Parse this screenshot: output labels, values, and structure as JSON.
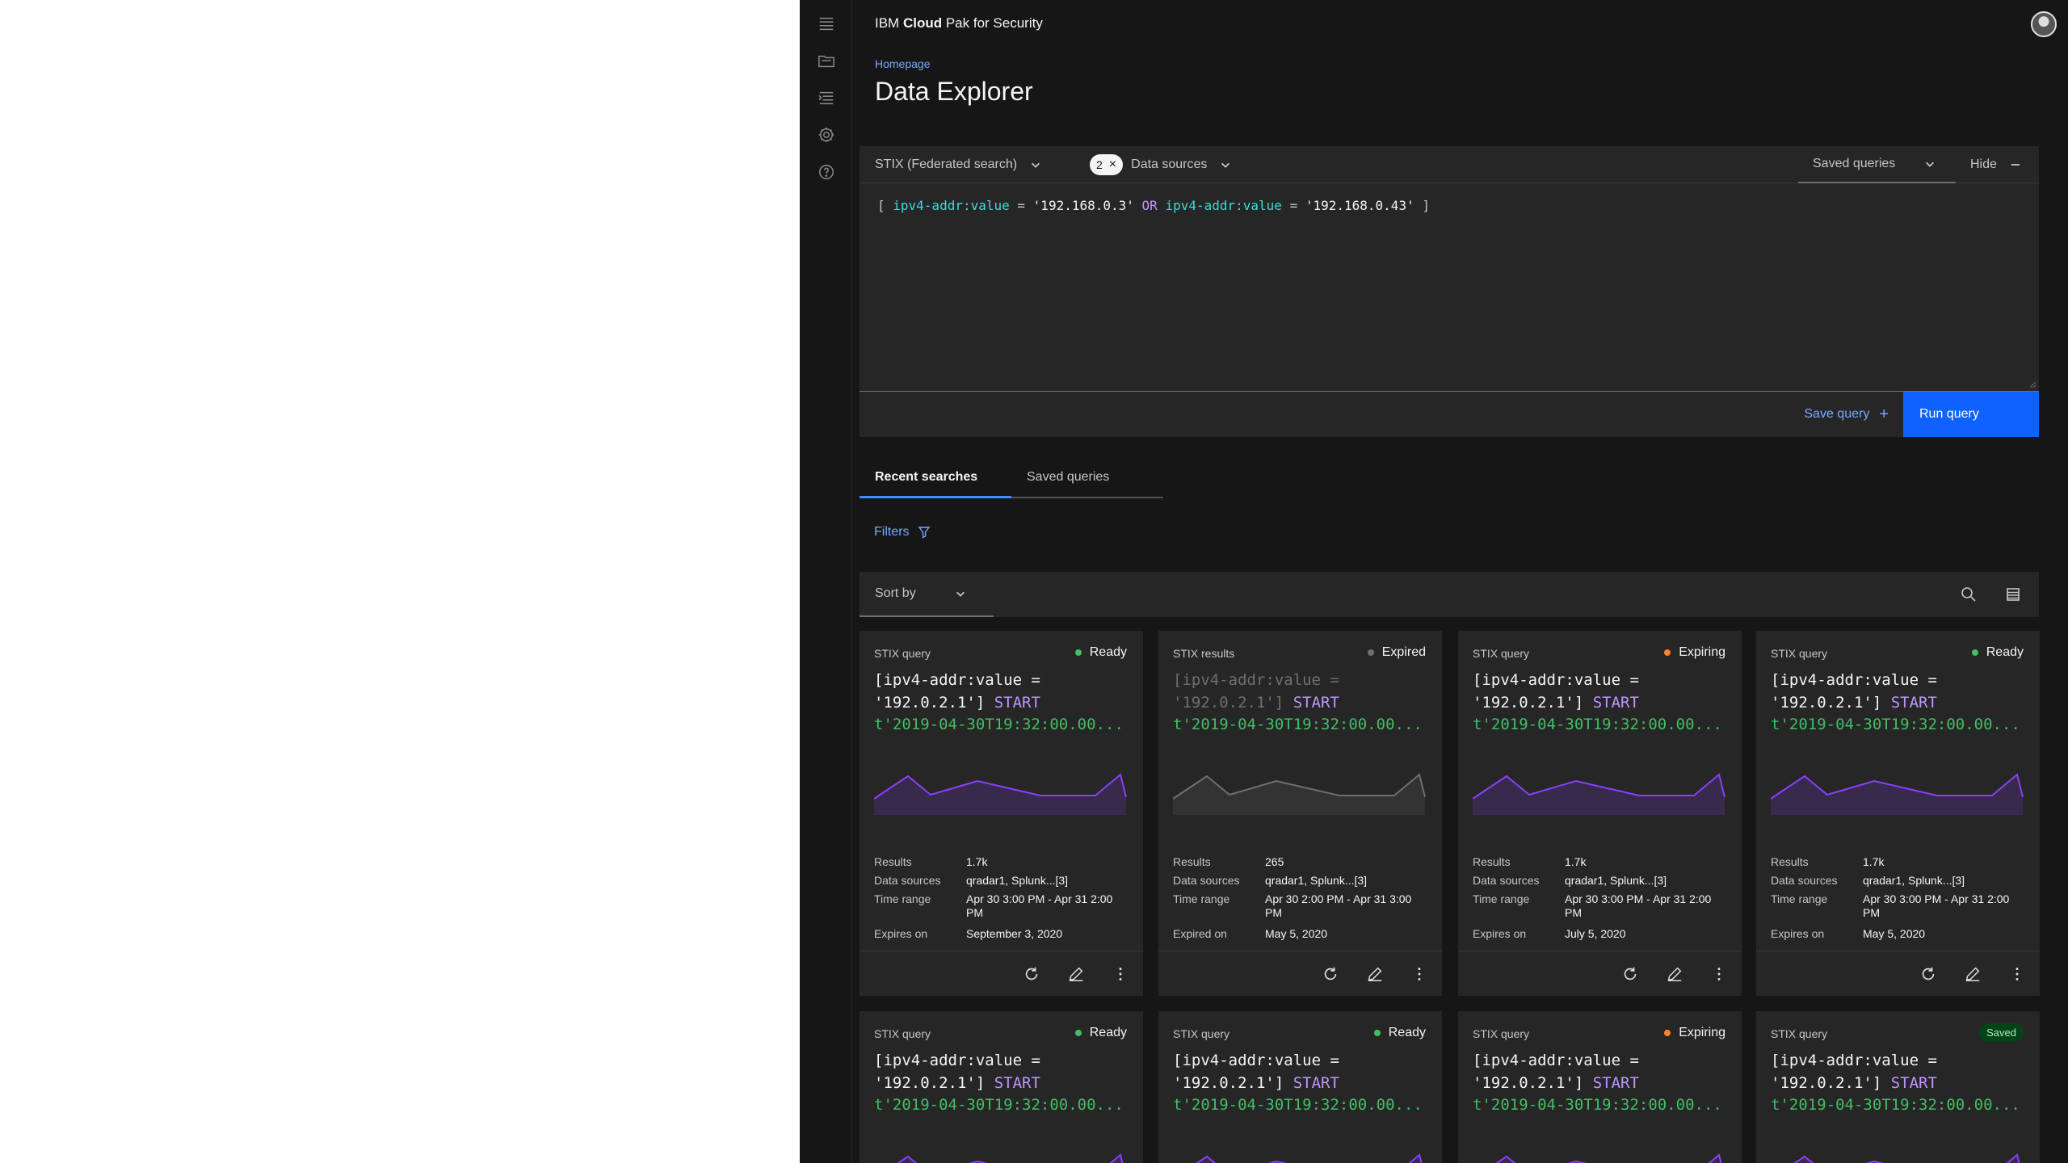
{
  "header": {
    "brand_prefix": "IBM ",
    "brand_bold": "Cloud",
    "brand_suffix": " Pak for Security",
    "icons": [
      "notification-icon",
      "user-avatar"
    ]
  },
  "rail": {
    "icons": [
      "menu-icon",
      "folder-icon",
      "list-icon",
      "settings-icon",
      "help-icon"
    ]
  },
  "breadcrumb": "Homepage",
  "page_title": "Data Explorer",
  "query": {
    "language": "STIX (Federated search)",
    "data_sources_count": "2",
    "data_sources_label": "Data sources",
    "saved_queries_label": "Saved queries",
    "hide_label": "Hide",
    "code": {
      "open": "[ ",
      "attr1": "ipv4-addr:value",
      "eq1": " = ",
      "val1": "'192.168.0.3'",
      "op": " OR ",
      "attr2": "ipv4-addr:value",
      "eq2": " = ",
      "val2": "'192.168.0.43'",
      "close": " ]"
    },
    "save_label": "Save query",
    "run_label": "Run query"
  },
  "tabs": [
    "Recent searches",
    "Saved queries"
  ],
  "filters_label": "Filters",
  "sort_label": "Sort by",
  "colors": {
    "ready": "#42be65",
    "expired": "#6f6f6f",
    "expiring": "#ff832b",
    "accent": "#0f62fe",
    "spark": "#8a3ffc"
  },
  "cards": [
    {
      "type": "STIX query",
      "status": "Ready",
      "q1": "[ipv4-addr:value =",
      "q2a": "'192.0.2.1'] ",
      "q2b": "START",
      "q3": "t'2019-04-30T19:32:00.00...",
      "results": "1.7k",
      "sources": "qradar1, Splunk...[3]",
      "time_range": "Apr 30 3:00 PM - Apr 31 2:00 PM",
      "exp_label": "Expires on",
      "exp_date": "September 3, 2020"
    },
    {
      "type": "STIX results",
      "status": "Expired",
      "q1": "[ipv4-addr:value =",
      "q2a": "'192.0.2.1'] ",
      "q2b": "START",
      "q3": "t'2019-04-30T19:32:00.00...",
      "results": "265",
      "sources": "qradar1, Splunk...[3]",
      "time_range": "Apr 30 2:00 PM - Apr 31 3:00 PM",
      "exp_label": "Expired on",
      "exp_date": "May 5, 2020"
    },
    {
      "type": "STIX query",
      "status": "Expiring",
      "q1": "[ipv4-addr:value =",
      "q2a": "'192.0.2.1'] ",
      "q2b": "START",
      "q3": "t'2019-04-30T19:32:00.00...",
      "results": "1.7k",
      "sources": "qradar1, Splunk...[3]",
      "time_range": "Apr 30 3:00 PM - Apr 31 2:00 PM",
      "exp_label": "Expires on",
      "exp_date": "July 5, 2020"
    },
    {
      "type": "STIX query",
      "status": "Ready",
      "q1": "[ipv4-addr:value =",
      "q2a": "'192.0.2.1'] ",
      "q2b": "START",
      "q3": "t'2019-04-30T19:32:00.00...",
      "results": "1.7k",
      "sources": "qradar1, Splunk...[3]",
      "time_range": "Apr 30 3:00 PM - Apr 31 2:00 PM",
      "exp_label": "Expires on",
      "exp_date": "May 5, 2020"
    },
    {
      "type": "STIX query",
      "status": "Ready",
      "q1": "[ipv4-addr:value =",
      "q2a": "'192.0.2.1'] ",
      "q2b": "START",
      "q3": "t'2019-04-30T19:32:00.00..."
    },
    {
      "type": "STIX query",
      "status": "Ready",
      "q1": "[ipv4-addr:value =",
      "q2a": "'192.0.2.1'] ",
      "q2b": "START",
      "q3": "t'2019-04-30T19:32:00.00..."
    },
    {
      "type": "STIX query",
      "status": "Expiring",
      "q1": "[ipv4-addr:value =",
      "q2a": "'192.0.2.1'] ",
      "q2b": "START",
      "q3": "t'2019-04-30T19:32:00.00..."
    },
    {
      "type": "STIX query",
      "status": "Saved",
      "q1": "[ipv4-addr:value =",
      "q2a": "'192.0.2.1'] ",
      "q2b": "START",
      "q3": "t'2019-04-30T19:32:00.00..."
    }
  ],
  "meta_labels": {
    "results": "Results",
    "sources": "Data sources",
    "time_range": "Time range"
  }
}
